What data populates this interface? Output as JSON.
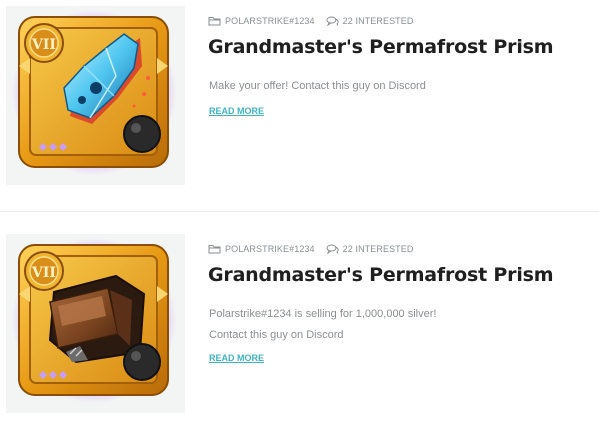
{
  "listings": [
    {
      "seller": "POLARSTRIKE#1234",
      "interested": "22 INTERESTED",
      "title": "Grandmaster's Permafrost Prism",
      "description": [
        "Make your offer! Contact this guy on Discord"
      ],
      "read_more": "READ MORE",
      "thumbnail": {
        "tier": "VII",
        "item_icon": "frost-prism-icon",
        "frame_color": "#e8a21a",
        "glow_color": "#b46ef0"
      }
    },
    {
      "seller": "POLARSTRIKE#1234",
      "interested": "22 INTERESTED",
      "title": "Grandmaster's Permafrost Prism",
      "description": [
        "Polarstrike#1234 is selling for 1,000,000 silver!",
        "Contact this guy on Discord"
      ],
      "read_more": "READ MORE",
      "thumbnail": {
        "tier": "VII",
        "item_icon": "leather-bag-icon",
        "frame_color": "#e8a21a",
        "glow_color": "#b46ef0"
      }
    }
  ],
  "colors": {
    "accent": "#3fb4c0",
    "meta_text": "#8a8f93",
    "title_text": "#1f1f1f",
    "thumb_bg": "#f3f4f4"
  }
}
